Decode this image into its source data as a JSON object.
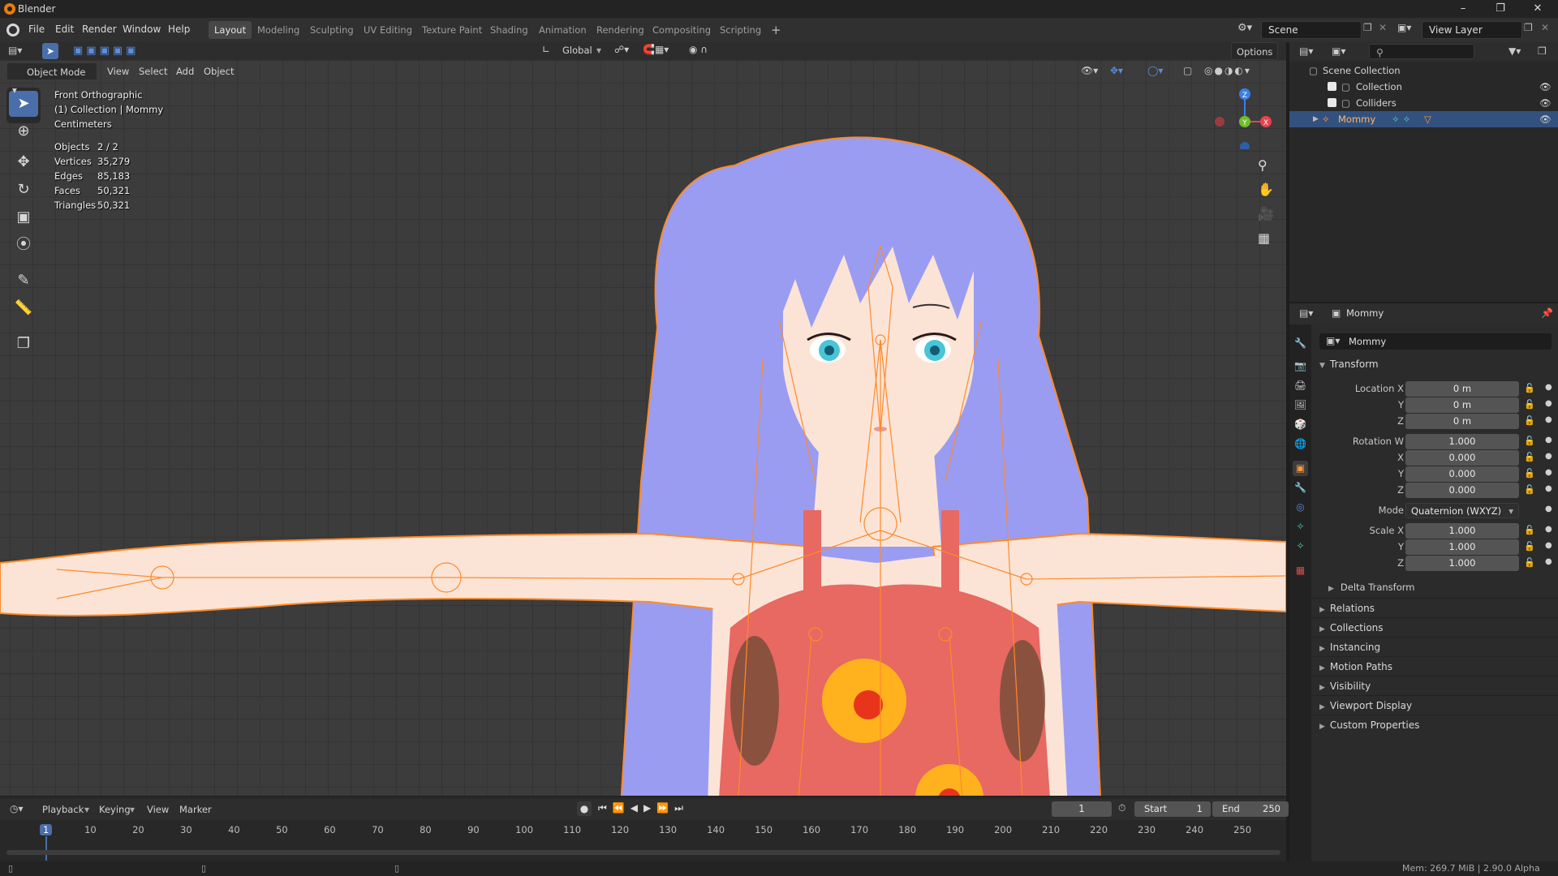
{
  "app": {
    "title": "Blender"
  },
  "menu": [
    "File",
    "Edit",
    "Render",
    "Window",
    "Help"
  ],
  "workspaces": [
    {
      "label": "Layout",
      "active": true
    },
    {
      "label": "Modeling"
    },
    {
      "label": "Sculpting"
    },
    {
      "label": "UV Editing"
    },
    {
      "label": "Texture Paint"
    },
    {
      "label": "Shading"
    },
    {
      "label": "Animation"
    },
    {
      "label": "Rendering"
    },
    {
      "label": "Compositing"
    },
    {
      "label": "Scripting"
    }
  ],
  "scene": {
    "name": "Scene"
  },
  "view_layer": {
    "name": "View Layer"
  },
  "viewport_header": {
    "mode": "Object Mode",
    "menus": [
      "View",
      "Select",
      "Add",
      "Object"
    ],
    "transform_orientation": "Global",
    "options": "Options"
  },
  "overlay": {
    "view_name": "Front Orthographic",
    "collection_line": "(1) Collection | Mommy",
    "units": "Centimeters",
    "stats": [
      {
        "label": "Objects",
        "value": "2 / 2"
      },
      {
        "label": "Vertices",
        "value": "35,279"
      },
      {
        "label": "Edges",
        "value": "85,183"
      },
      {
        "label": "Faces",
        "value": "50,321"
      },
      {
        "label": "Triangles",
        "value": "50,321"
      }
    ]
  },
  "gizmo_axes": {
    "z": "Z",
    "y": "Y",
    "x": "X"
  },
  "outliner": {
    "root": "Scene Collection",
    "items": [
      {
        "label": "Collection"
      },
      {
        "label": "Colliders"
      },
      {
        "label": "Mommy",
        "selected": true
      }
    ]
  },
  "properties": {
    "object_name": "Mommy",
    "data_name": "Mommy",
    "transform_title": "Transform",
    "location": [
      {
        "label": "Location X",
        "value": "0 m"
      },
      {
        "label": "Y",
        "value": "0 m"
      },
      {
        "label": "Z",
        "value": "0 m"
      }
    ],
    "rotation": [
      {
        "label": "Rotation W",
        "value": "1.000"
      },
      {
        "label": "X",
        "value": "0.000"
      },
      {
        "label": "Y",
        "value": "0.000"
      },
      {
        "label": "Z",
        "value": "0.000"
      }
    ],
    "mode_label": "Mode",
    "mode_value": "Quaternion (WXYZ)",
    "scale": [
      {
        "label": "Scale X",
        "value": "1.000"
      },
      {
        "label": "Y",
        "value": "1.000"
      },
      {
        "label": "Z",
        "value": "1.000"
      }
    ],
    "delta": "Delta Transform",
    "panels": [
      "Relations",
      "Collections",
      "Instancing",
      "Motion Paths",
      "Visibility",
      "Viewport Display",
      "Custom Properties"
    ]
  },
  "timeline": {
    "menus": [
      "Playback",
      "Keying",
      "View",
      "Marker"
    ],
    "current_frame": "1",
    "start_label": "Start",
    "start": "1",
    "end_label": "End",
    "end": "250",
    "ticks": [
      "1",
      "10",
      "20",
      "30",
      "40",
      "50",
      "60",
      "70",
      "80",
      "90",
      "100",
      "110",
      "120",
      "130",
      "140",
      "150",
      "160",
      "170",
      "180",
      "190",
      "200",
      "210",
      "220",
      "230",
      "240",
      "250"
    ]
  },
  "status": {
    "memory": "Mem: 269.7 MiB | 2.90.0 Alpha"
  },
  "colors": {
    "accent": "#4a6ea9",
    "selection": "#33517e",
    "bone_orange": "#ff8a2a",
    "hair": "#9a9cf2",
    "skin": "#fbe4d6",
    "dress": "#e86862"
  }
}
